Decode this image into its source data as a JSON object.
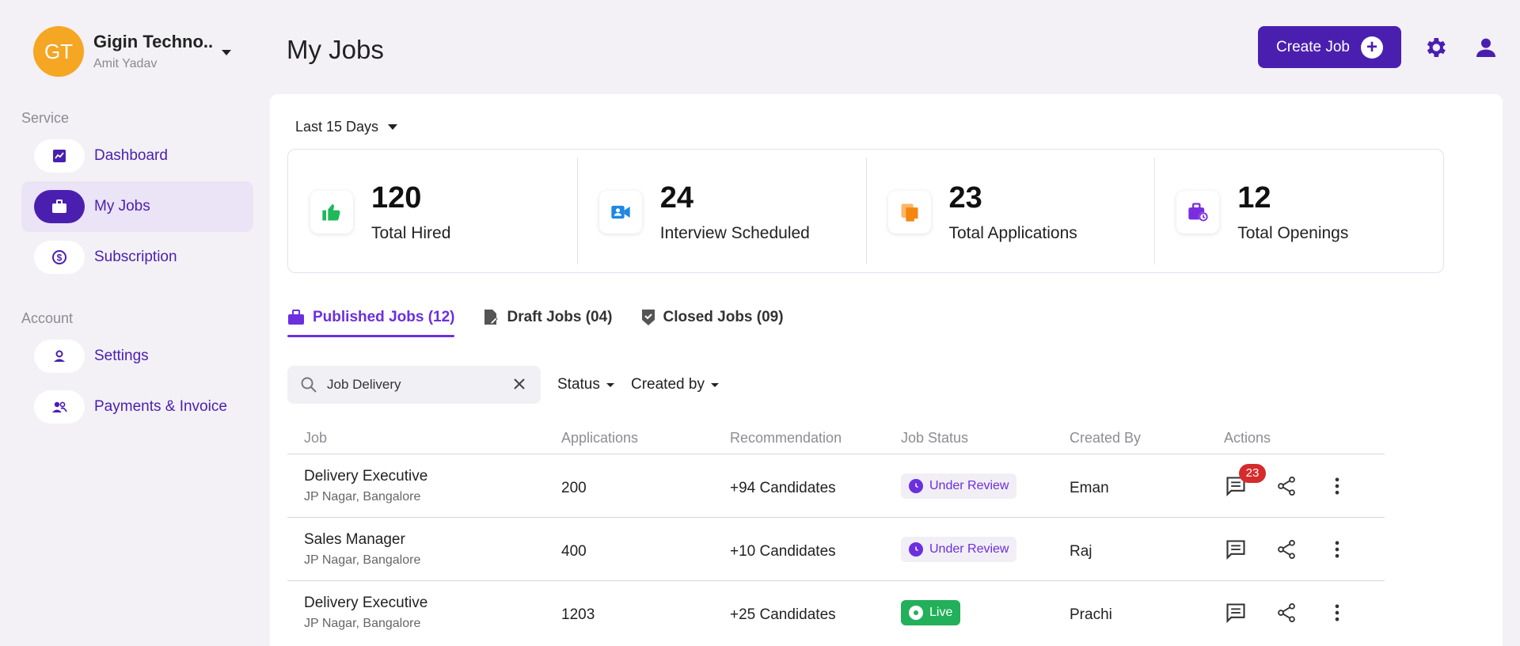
{
  "org": {
    "initials": "GT",
    "name": "Gigin Techno..",
    "user": "Amit Yadav"
  },
  "sidebar": {
    "service_label": "Service",
    "account_label": "Account",
    "service_items": [
      {
        "label": "Dashboard",
        "icon": "chart-icon"
      },
      {
        "label": "My Jobs",
        "icon": "briefcase-icon"
      },
      {
        "label": "Subscription",
        "icon": "dollar-icon"
      }
    ],
    "account_items": [
      {
        "label": "Settings",
        "icon": "person-icon"
      },
      {
        "label": "Payments & Invoice",
        "icon": "people-icon"
      }
    ]
  },
  "header": {
    "title": "My Jobs",
    "create_label": "Create Job"
  },
  "range": {
    "selected": "Last 15 Days"
  },
  "stats": [
    {
      "value": "120",
      "label": "Total Hired",
      "icon": "thumbs-up-icon",
      "color": "#1fb85a"
    },
    {
      "value": "24",
      "label": "Interview Scheduled",
      "icon": "video-person-icon",
      "color": "#1e88e5"
    },
    {
      "value": "23",
      "label": "Total Applications",
      "icon": "copy-docs-icon",
      "color": "#f5860f"
    },
    {
      "value": "12",
      "label": "Total Openings",
      "icon": "briefcase-clock-icon",
      "color": "#7a2ce0"
    }
  ],
  "tabs": [
    {
      "label": "Published Jobs (12)"
    },
    {
      "label": "Draft Jobs (04)"
    },
    {
      "label": "Closed Jobs (09)"
    }
  ],
  "filters": {
    "search_value": "Job Delivery",
    "status_label": "Status",
    "created_by_label": "Created by"
  },
  "table": {
    "columns": [
      "Job",
      "Applications",
      "Recommendation",
      "Job Status",
      "Created By",
      "Actions"
    ],
    "rows": [
      {
        "title": "Delivery Executive",
        "location": "JP Nagar, Bangalore",
        "applications": "200",
        "recommendation": "+94 Candidates",
        "status": "Under Review",
        "created_by": "Eman"
      },
      {
        "title": "Sales Manager",
        "location": "JP Nagar, Bangalore",
        "applications": "400",
        "recommendation": "+10 Candidates",
        "status": "Under Review",
        "created_by": "Raj"
      },
      {
        "title": "Delivery Executive",
        "location": "JP Nagar, Bangalore",
        "applications": "1203",
        "recommendation": "+25 Candidates",
        "status": "Live",
        "created_by": "Prachi"
      }
    ],
    "message_badge": "23"
  },
  "colors": {
    "accent": "#4a1fb0",
    "tab_active": "#6b2fe0",
    "live": "#22b05a",
    "badge": "#d62b2b"
  }
}
